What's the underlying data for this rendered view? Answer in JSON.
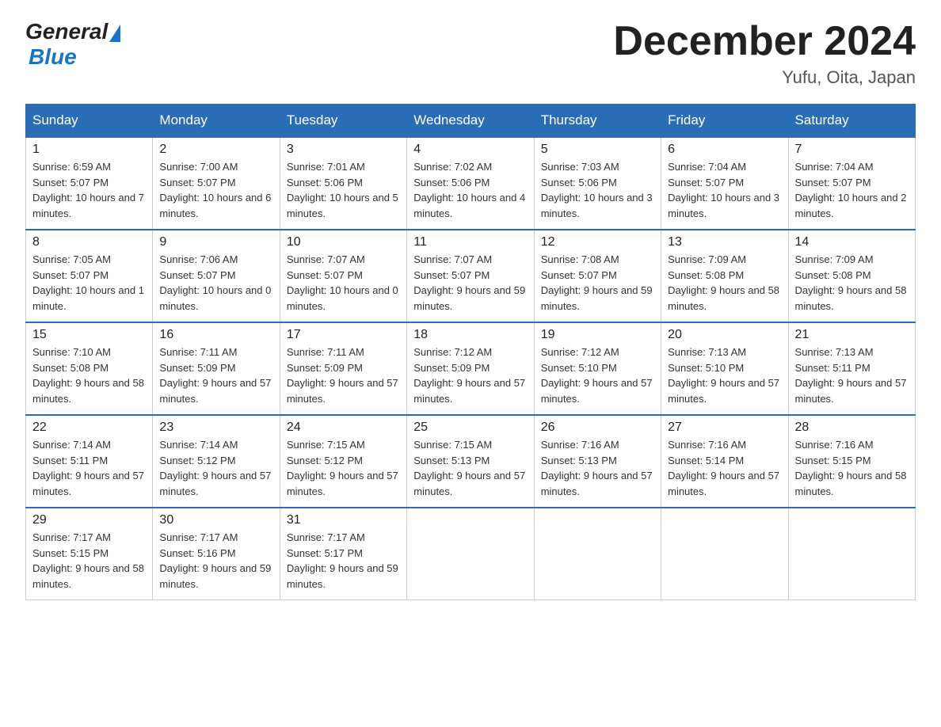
{
  "header": {
    "logo_general": "General",
    "logo_blue": "Blue",
    "month_title": "December 2024",
    "location": "Yufu, Oita, Japan"
  },
  "days_of_week": [
    "Sunday",
    "Monday",
    "Tuesday",
    "Wednesday",
    "Thursday",
    "Friday",
    "Saturday"
  ],
  "weeks": [
    [
      {
        "day": "1",
        "sunrise": "6:59 AM",
        "sunset": "5:07 PM",
        "daylight": "10 hours and 7 minutes."
      },
      {
        "day": "2",
        "sunrise": "7:00 AM",
        "sunset": "5:07 PM",
        "daylight": "10 hours and 6 minutes."
      },
      {
        "day": "3",
        "sunrise": "7:01 AM",
        "sunset": "5:06 PM",
        "daylight": "10 hours and 5 minutes."
      },
      {
        "day": "4",
        "sunrise": "7:02 AM",
        "sunset": "5:06 PM",
        "daylight": "10 hours and 4 minutes."
      },
      {
        "day": "5",
        "sunrise": "7:03 AM",
        "sunset": "5:06 PM",
        "daylight": "10 hours and 3 minutes."
      },
      {
        "day": "6",
        "sunrise": "7:04 AM",
        "sunset": "5:07 PM",
        "daylight": "10 hours and 3 minutes."
      },
      {
        "day": "7",
        "sunrise": "7:04 AM",
        "sunset": "5:07 PM",
        "daylight": "10 hours and 2 minutes."
      }
    ],
    [
      {
        "day": "8",
        "sunrise": "7:05 AM",
        "sunset": "5:07 PM",
        "daylight": "10 hours and 1 minute."
      },
      {
        "day": "9",
        "sunrise": "7:06 AM",
        "sunset": "5:07 PM",
        "daylight": "10 hours and 0 minutes."
      },
      {
        "day": "10",
        "sunrise": "7:07 AM",
        "sunset": "5:07 PM",
        "daylight": "10 hours and 0 minutes."
      },
      {
        "day": "11",
        "sunrise": "7:07 AM",
        "sunset": "5:07 PM",
        "daylight": "9 hours and 59 minutes."
      },
      {
        "day": "12",
        "sunrise": "7:08 AM",
        "sunset": "5:07 PM",
        "daylight": "9 hours and 59 minutes."
      },
      {
        "day": "13",
        "sunrise": "7:09 AM",
        "sunset": "5:08 PM",
        "daylight": "9 hours and 58 minutes."
      },
      {
        "day": "14",
        "sunrise": "7:09 AM",
        "sunset": "5:08 PM",
        "daylight": "9 hours and 58 minutes."
      }
    ],
    [
      {
        "day": "15",
        "sunrise": "7:10 AM",
        "sunset": "5:08 PM",
        "daylight": "9 hours and 58 minutes."
      },
      {
        "day": "16",
        "sunrise": "7:11 AM",
        "sunset": "5:09 PM",
        "daylight": "9 hours and 57 minutes."
      },
      {
        "day": "17",
        "sunrise": "7:11 AM",
        "sunset": "5:09 PM",
        "daylight": "9 hours and 57 minutes."
      },
      {
        "day": "18",
        "sunrise": "7:12 AM",
        "sunset": "5:09 PM",
        "daylight": "9 hours and 57 minutes."
      },
      {
        "day": "19",
        "sunrise": "7:12 AM",
        "sunset": "5:10 PM",
        "daylight": "9 hours and 57 minutes."
      },
      {
        "day": "20",
        "sunrise": "7:13 AM",
        "sunset": "5:10 PM",
        "daylight": "9 hours and 57 minutes."
      },
      {
        "day": "21",
        "sunrise": "7:13 AM",
        "sunset": "5:11 PM",
        "daylight": "9 hours and 57 minutes."
      }
    ],
    [
      {
        "day": "22",
        "sunrise": "7:14 AM",
        "sunset": "5:11 PM",
        "daylight": "9 hours and 57 minutes."
      },
      {
        "day": "23",
        "sunrise": "7:14 AM",
        "sunset": "5:12 PM",
        "daylight": "9 hours and 57 minutes."
      },
      {
        "day": "24",
        "sunrise": "7:15 AM",
        "sunset": "5:12 PM",
        "daylight": "9 hours and 57 minutes."
      },
      {
        "day": "25",
        "sunrise": "7:15 AM",
        "sunset": "5:13 PM",
        "daylight": "9 hours and 57 minutes."
      },
      {
        "day": "26",
        "sunrise": "7:16 AM",
        "sunset": "5:13 PM",
        "daylight": "9 hours and 57 minutes."
      },
      {
        "day": "27",
        "sunrise": "7:16 AM",
        "sunset": "5:14 PM",
        "daylight": "9 hours and 57 minutes."
      },
      {
        "day": "28",
        "sunrise": "7:16 AM",
        "sunset": "5:15 PM",
        "daylight": "9 hours and 58 minutes."
      }
    ],
    [
      {
        "day": "29",
        "sunrise": "7:17 AM",
        "sunset": "5:15 PM",
        "daylight": "9 hours and 58 minutes."
      },
      {
        "day": "30",
        "sunrise": "7:17 AM",
        "sunset": "5:16 PM",
        "daylight": "9 hours and 59 minutes."
      },
      {
        "day": "31",
        "sunrise": "7:17 AM",
        "sunset": "5:17 PM",
        "daylight": "9 hours and 59 minutes."
      },
      null,
      null,
      null,
      null
    ]
  ]
}
